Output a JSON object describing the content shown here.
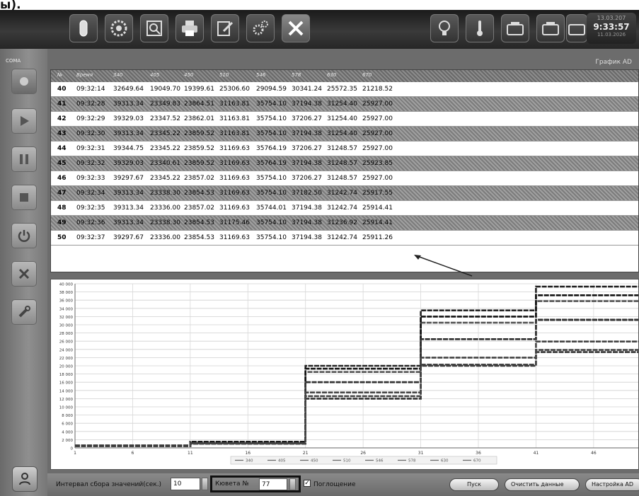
{
  "caption": "ы).",
  "clock": {
    "date": "13.03.207",
    "time": "9:33:57",
    "sub": "11.03.2026"
  },
  "sidebar": {
    "label": "COMA"
  },
  "window_title": "График AD",
  "table": {
    "headers": [
      "№",
      "Время",
      "340",
      "405",
      "450",
      "510",
      "546",
      "578",
      "630",
      "670"
    ],
    "rows": [
      {
        "n": "40",
        "time": "09:32:14",
        "v": [
          "32649.64",
          "19049.70",
          "19399.61",
          "25306.60",
          "29094.59",
          "30341.24",
          "25572.35",
          "21218.52"
        ]
      },
      {
        "n": "41",
        "time": "09:32:28",
        "v": [
          "39313.34",
          "23349.83",
          "23864.51",
          "31163.81",
          "35754.10",
          "37194.38",
          "31254.40",
          "25927.00"
        ]
      },
      {
        "n": "42",
        "time": "09:32:29",
        "v": [
          "39329.03",
          "23347.52",
          "23862.01",
          "31163.81",
          "35754.10",
          "37206.27",
          "31254.40",
          "25927.00"
        ]
      },
      {
        "n": "43",
        "time": "09:32:30",
        "v": [
          "39313.34",
          "23345.22",
          "23859.52",
          "31163.81",
          "35754.10",
          "37194.38",
          "31254.40",
          "25927.00"
        ]
      },
      {
        "n": "44",
        "time": "09:32:31",
        "v": [
          "39344.75",
          "23345.22",
          "23859.52",
          "31169.63",
          "35764.19",
          "37206.27",
          "31248.57",
          "25927.00"
        ]
      },
      {
        "n": "45",
        "time": "09:32:32",
        "v": [
          "39329.03",
          "23340.61",
          "23859.52",
          "31169.63",
          "35764.19",
          "37194.38",
          "31248.57",
          "25923.85"
        ]
      },
      {
        "n": "46",
        "time": "09:32:33",
        "v": [
          "39297.67",
          "23345.22",
          "23857.02",
          "31169.63",
          "35754.10",
          "37206.27",
          "31248.57",
          "25927.00"
        ]
      },
      {
        "n": "47",
        "time": "09:32:34",
        "v": [
          "39313.34",
          "23338.30",
          "23854.53",
          "31169.63",
          "35754.10",
          "37182.50",
          "31242.74",
          "25917.55"
        ]
      },
      {
        "n": "48",
        "time": "09:32:35",
        "v": [
          "39313.34",
          "23336.00",
          "23857.02",
          "31169.63",
          "35744.01",
          "37194.38",
          "31242.74",
          "25914.41"
        ]
      },
      {
        "n": "49",
        "time": "09:32:36",
        "v": [
          "39313.34",
          "23338.30",
          "23854.53",
          "31175.46",
          "35754.10",
          "37194.38",
          "31236.92",
          "25914.41"
        ]
      },
      {
        "n": "50",
        "time": "09:32:37",
        "v": [
          "39297.67",
          "23336.00",
          "23854.53",
          "31169.63",
          "35754.10",
          "37194.38",
          "31242.74",
          "25911.26"
        ]
      }
    ]
  },
  "chart_data": {
    "type": "line",
    "xlabel": "",
    "ylabel": "",
    "ylim": [
      0,
      40000
    ],
    "yticks": [
      "0",
      "2 000",
      "4 000",
      "6 000",
      "8 000",
      "10 000",
      "12 000",
      "14 000",
      "16 000",
      "18 000",
      "20 000",
      "22 000",
      "24 000",
      "26 000",
      "28 000",
      "30 000",
      "32 000",
      "34 000",
      "36 000",
      "38 000",
      "40 000"
    ],
    "xticks": [
      "1",
      "6",
      "11",
      "16",
      "21",
      "26",
      "31",
      "36",
      "41",
      "46"
    ],
    "xlim": [
      1,
      50
    ],
    "grid": true,
    "legend": [
      "340",
      "405",
      "450",
      "510",
      "546",
      "578",
      "630",
      "670"
    ],
    "legend_position": "bottom",
    "series": [
      {
        "name": "340",
        "color": "#222222",
        "values": [
          [
            1,
            600
          ],
          [
            11,
            600
          ],
          [
            11,
            1500
          ],
          [
            21,
            1500
          ],
          [
            21,
            20000
          ],
          [
            31,
            20000
          ],
          [
            31,
            33500
          ],
          [
            41,
            33500
          ],
          [
            41,
            39300
          ],
          [
            50,
            39300
          ]
        ]
      },
      {
        "name": "405",
        "color": "#333333",
        "values": [
          [
            1,
            500
          ],
          [
            11,
            500
          ],
          [
            11,
            1000
          ],
          [
            21,
            1000
          ],
          [
            21,
            12000
          ],
          [
            31,
            12000
          ],
          [
            31,
            20000
          ],
          [
            41,
            20000
          ],
          [
            41,
            23340
          ],
          [
            50,
            23340
          ]
        ]
      },
      {
        "name": "450",
        "color": "#444444",
        "values": [
          [
            1,
            500
          ],
          [
            11,
            500
          ],
          [
            11,
            1000
          ],
          [
            21,
            1000
          ],
          [
            21,
            12600
          ],
          [
            31,
            12600
          ],
          [
            31,
            20300
          ],
          [
            41,
            20300
          ],
          [
            41,
            23860
          ],
          [
            50,
            23860
          ]
        ]
      },
      {
        "name": "510",
        "color": "#222222",
        "values": [
          [
            1,
            400
          ],
          [
            11,
            400
          ],
          [
            11,
            1200
          ],
          [
            21,
            1200
          ],
          [
            21,
            16000
          ],
          [
            31,
            16000
          ],
          [
            31,
            26500
          ],
          [
            41,
            26500
          ],
          [
            41,
            31170
          ],
          [
            50,
            31170
          ]
        ]
      },
      {
        "name": "546",
        "color": "#555555",
        "values": [
          [
            1,
            400
          ],
          [
            11,
            400
          ],
          [
            11,
            1300
          ],
          [
            21,
            1300
          ],
          [
            21,
            18500
          ],
          [
            31,
            18500
          ],
          [
            31,
            30500
          ],
          [
            41,
            30500
          ],
          [
            41,
            35750
          ],
          [
            50,
            35750
          ]
        ]
      },
      {
        "name": "578",
        "color": "#111111",
        "values": [
          [
            1,
            500
          ],
          [
            11,
            500
          ],
          [
            11,
            1400
          ],
          [
            21,
            1400
          ],
          [
            21,
            19300
          ],
          [
            31,
            19300
          ],
          [
            31,
            32000
          ],
          [
            41,
            32000
          ],
          [
            41,
            37194
          ],
          [
            50,
            37194
          ]
        ]
      },
      {
        "name": "630",
        "color": "#333333",
        "values": [
          [
            1,
            400
          ],
          [
            11,
            400
          ],
          [
            11,
            1200
          ],
          [
            21,
            1200
          ],
          [
            21,
            16000
          ],
          [
            31,
            16000
          ],
          [
            31,
            26500
          ],
          [
            41,
            26500
          ],
          [
            41,
            31243
          ],
          [
            50,
            31243
          ]
        ]
      },
      {
        "name": "670",
        "color": "#444444",
        "values": [
          [
            1,
            400
          ],
          [
            11,
            400
          ],
          [
            11,
            1100
          ],
          [
            21,
            1100
          ],
          [
            21,
            13500
          ],
          [
            31,
            13500
          ],
          [
            31,
            22000
          ],
          [
            41,
            22000
          ],
          [
            41,
            25911
          ],
          [
            50,
            25911
          ]
        ]
      }
    ]
  },
  "bottom": {
    "interval_label": "Интервал сбора значений(сек.)",
    "interval_value": "10",
    "cuvette_label": "Кювета №",
    "cuvette_value": "77",
    "absorb_label": "Поглощение",
    "btn_start": "Пуск",
    "btn_clear": "Очистить данные",
    "btn_settings": "Настройка AD"
  }
}
